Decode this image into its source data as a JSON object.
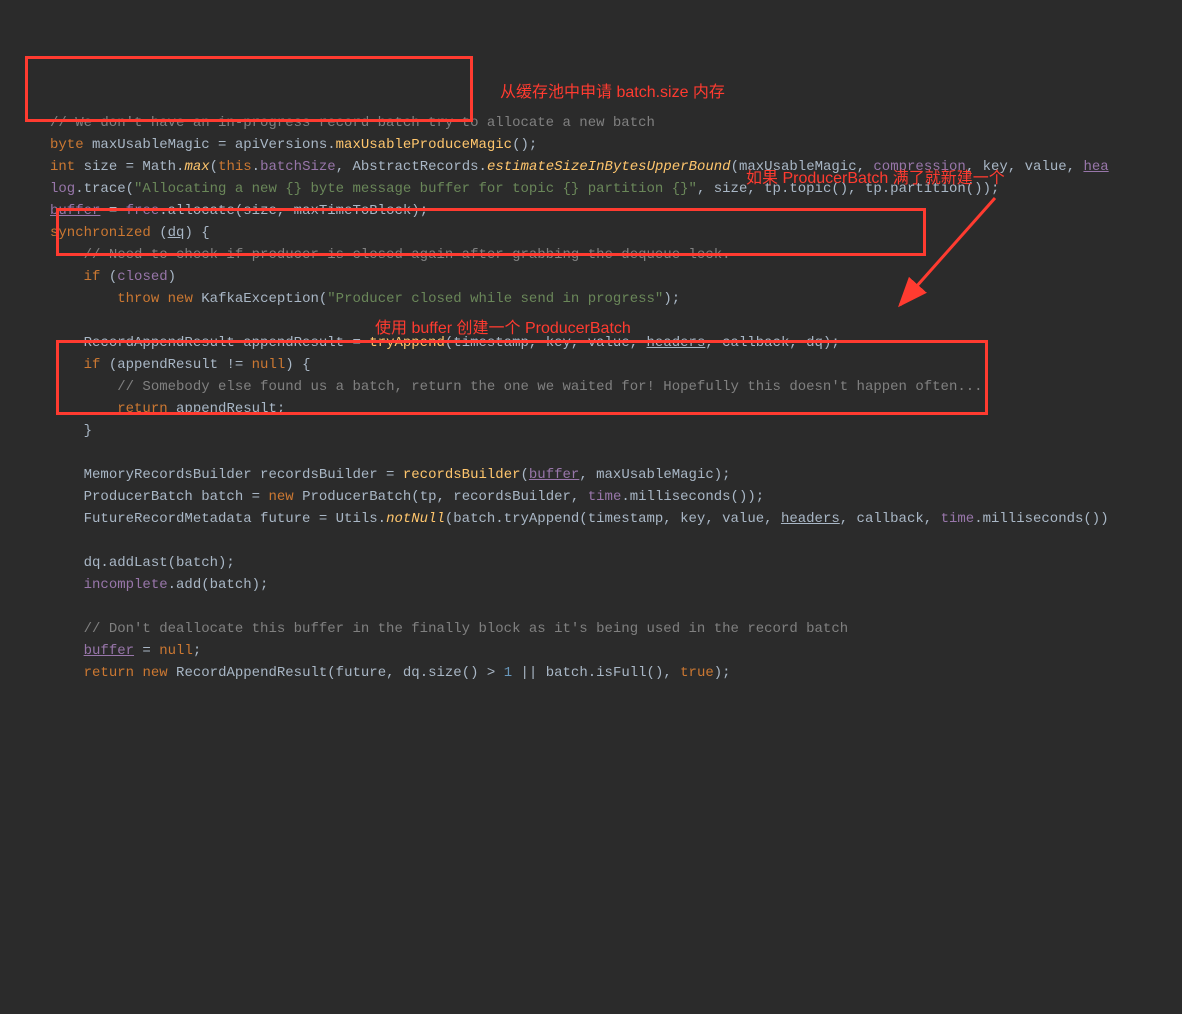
{
  "lines": {
    "l0_comment": "// We don't have an in-progress record batch try to allocate a new batch",
    "l1_byte": "byte",
    "l1_var": " maxUsableMagic = apiVersions.",
    "l1_method": "maxUsableProduceMagic",
    "l1_end": "();",
    "l2_int": "int",
    "l2_size": " size = Math.",
    "l2_max": "max",
    "l2_p1": "(",
    "l2_this": "this",
    "l2_dot1": ".",
    "l2_batchsize": "batchSize",
    "l2_comma1": ", AbstractRecords.",
    "l2_estimate": "estimateSizeInBytesUpperBound",
    "l2_p2": "(maxUsableMagic, ",
    "l2_compression": "compression",
    "l2_p3": ", key, value, ",
    "l2_hea": "hea",
    "l3_log": "log",
    "l3_trace": ".trace(",
    "l3_string": "\"Allocating a new {} byte message buffer for topic {} partition {}\"",
    "l3_args": ", size, tp.topic(), tp.partition());",
    "l4_buffer": "buffer",
    "l4_eq": " = ",
    "l4_free": "free",
    "l4_allocate": ".allocate(size, maxTimeToBlock);",
    "l5_sync": "synchronized",
    "l5_sp": " (",
    "l5_dq": "dq",
    "l5_brace": ") {",
    "l6_comment": "// Need to check if producer is closed again after grabbing the dequeue lock.",
    "l7_if": "if",
    "l7_sp": " (",
    "l7_closed": "closed",
    "l7_end": ")",
    "l8_throw": "throw",
    "l8_sp": " ",
    "l8_new": "new",
    "l8_kafka": " KafkaException(",
    "l8_string": "\"Producer closed while send in progress\"",
    "l8_end": ");",
    "l10_type": "RecordAppendResult appendResult = ",
    "l10_method": "tryAppend",
    "l10_args": "(timestamp, key, value, ",
    "l10_headers": "headers",
    "l10_args2": ", callback, dq);",
    "l11_if": "if",
    "l11_sp": " (appendResult != ",
    "l11_null": "null",
    "l11_end": ") {",
    "l12_comment": "// Somebody else found us a batch, return the one we waited for! Hopefully this doesn't happen often...",
    "l13_return": "return",
    "l13_val": " appendResult;",
    "l14_brace": "}",
    "l16_type": "MemoryRecordsBuilder recordsBuilder = ",
    "l16_method": "recordsBuilder",
    "l16_p1": "(",
    "l16_buffer": "buffer",
    "l16_p2": ", maxUsableMagic);",
    "l17_type": "ProducerBatch batch = ",
    "l17_new": "new",
    "l17_pb": " ProducerBatch(tp, recordsBuilder, ",
    "l17_time": "time",
    "l17_ms": ".milliseconds());",
    "l18_type": "FutureRecordMetadata future = Utils.",
    "l18_notnull": "notNull",
    "l18_p1": "(batch.tryAppend(timestamp, key, value, ",
    "l18_headers": "headers",
    "l18_p2": ", callback, ",
    "l18_time": "time",
    "l18_ms": ".milliseconds())",
    "l20_dq": "dq.addLast(batch);",
    "l21_incomplete": "incomplete",
    "l21_add": ".add(batch);",
    "l23_comment": "// Don't deallocate this buffer in the finally block as it's being used in the record batch",
    "l24_buffer": "buffer",
    "l24_eq": " = ",
    "l24_null": "null",
    "l24_semi": ";",
    "l25_return": "return",
    "l25_sp": " ",
    "l25_new": "new",
    "l25_rar": " RecordAppendResult(future, dq.size() > ",
    "l25_one": "1",
    "l25_or": " || batch.isFull(), ",
    "l25_true": "true",
    "l25_end": ");"
  },
  "annotations": {
    "a1": "从缓存池中申请 batch.size 内存",
    "a2": "如果 ProducerBatch 满了就新建一个",
    "a3": "使用 buffer 创建一个 ProducerBatch"
  }
}
